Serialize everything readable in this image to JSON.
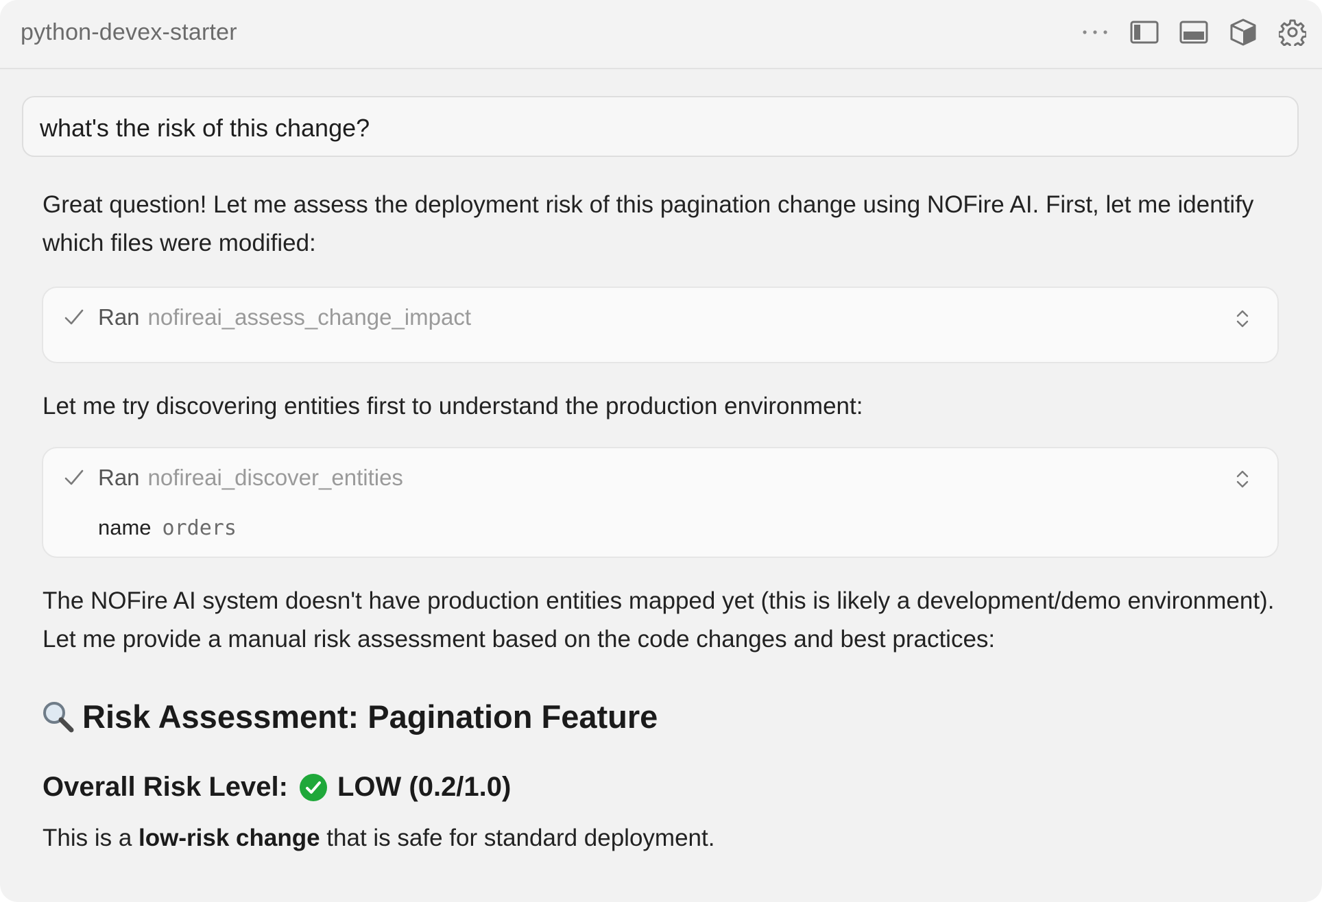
{
  "window": {
    "title": "python-devex-starter",
    "toolbar": [
      {
        "icon": "more-options-icon"
      },
      {
        "icon": "sidebar-toggle-icon"
      },
      {
        "icon": "panel-toggle-icon"
      },
      {
        "icon": "cube-icon"
      },
      {
        "icon": "gear-icon"
      }
    ]
  },
  "prompt": {
    "text": "what's the risk of this change?"
  },
  "response": {
    "intro": "Great question! Let me assess the deployment risk of this pagination change using NOFire AI. First, let me identify which files were modified:",
    "tool_call_1": {
      "status_label": "Ran",
      "tool_name": "nofireai_assess_change_impact"
    },
    "middle": "Let me try discovering entities first to understand the production environment:",
    "tool_call_2": {
      "status_label": "Ran",
      "tool_name": "nofireai_discover_entities",
      "param_key": "name",
      "param_value": "orders"
    },
    "explanation": "The NOFire AI system doesn't have production entities mapped yet (this is likely a development/demo environment). Let me provide a manual risk assessment based on the code changes and best practices:",
    "heading": "Risk Assessment: Pagination Feature",
    "risk_level": {
      "prefix": "Overall Risk Level:",
      "value": "LOW (0.2/1.0)",
      "status_color": "#1fa83a"
    },
    "closing": {
      "before": "This is a ",
      "bold": "low-risk change",
      "after": " that is safe for standard deployment."
    }
  },
  "colors": {
    "window_bg": "#f2f2f2",
    "card_bg": "#fafafa",
    "muted_text": "#9a9a9a",
    "ok_green": "#1fa83a"
  }
}
